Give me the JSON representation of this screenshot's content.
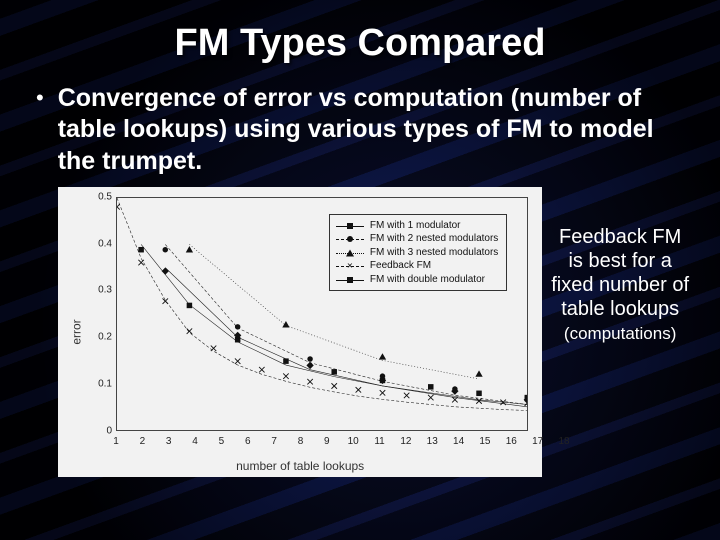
{
  "title": "FM Types Compared",
  "bullet": "Convergence of error vs computation (number of table lookups) using various types of FM to model the trumpet.",
  "caption_line1": "Feedback FM is best for a fixed number of table lookups",
  "caption_line2": "(computations)",
  "chart_data": {
    "type": "line",
    "title": "",
    "xlabel": "number of table lookups",
    "ylabel": "error",
    "xlim": [
      1,
      18
    ],
    "ylim": [
      0,
      0.5
    ],
    "yticks": [
      0,
      0.1,
      0.2,
      0.3,
      0.4,
      0.5
    ],
    "xticks": [
      1,
      2,
      3,
      4,
      5,
      6,
      7,
      8,
      9,
      10,
      11,
      12,
      13,
      14,
      15,
      16,
      17,
      18
    ],
    "legend_position": "upper right",
    "series": [
      {
        "name": "FM with 1 modulator",
        "marker": "square",
        "linestyle": "solid",
        "x": [
          2,
          4,
          6,
          8,
          10,
          12,
          14,
          16,
          18
        ],
        "y": [
          0.4,
          0.27,
          0.19,
          0.14,
          0.115,
          0.095,
          0.08,
          0.065,
          0.055
        ]
      },
      {
        "name": "FM with 2 nested modulators",
        "marker": "circle",
        "linestyle": "dashed",
        "x": [
          3,
          6,
          9,
          12,
          15,
          18
        ],
        "y": [
          0.4,
          0.22,
          0.145,
          0.105,
          0.075,
          0.055
        ]
      },
      {
        "name": "FM with 3 nested modulators",
        "marker": "triangle",
        "linestyle": "dotted",
        "x": [
          4,
          8,
          12,
          16
        ],
        "y": [
          0.4,
          0.225,
          0.15,
          0.11
        ]
      },
      {
        "name": "Feedback FM",
        "marker": "x",
        "linestyle": "dashed",
        "x": [
          1,
          2,
          3,
          4,
          5,
          6,
          7,
          8,
          9,
          10,
          11,
          12,
          13,
          14,
          15,
          16,
          17,
          18
        ],
        "y": [
          0.5,
          0.37,
          0.28,
          0.21,
          0.17,
          0.14,
          0.12,
          0.105,
          0.092,
          0.082,
          0.073,
          0.066,
          0.06,
          0.055,
          0.05,
          0.047,
          0.044,
          0.042
        ]
      },
      {
        "name": "FM with double modulator",
        "marker": "diamond",
        "linestyle": "solid",
        "x": [
          3,
          6,
          9,
          12,
          15,
          18
        ],
        "y": [
          0.35,
          0.2,
          0.13,
          0.095,
          0.07,
          0.05
        ]
      }
    ]
  }
}
